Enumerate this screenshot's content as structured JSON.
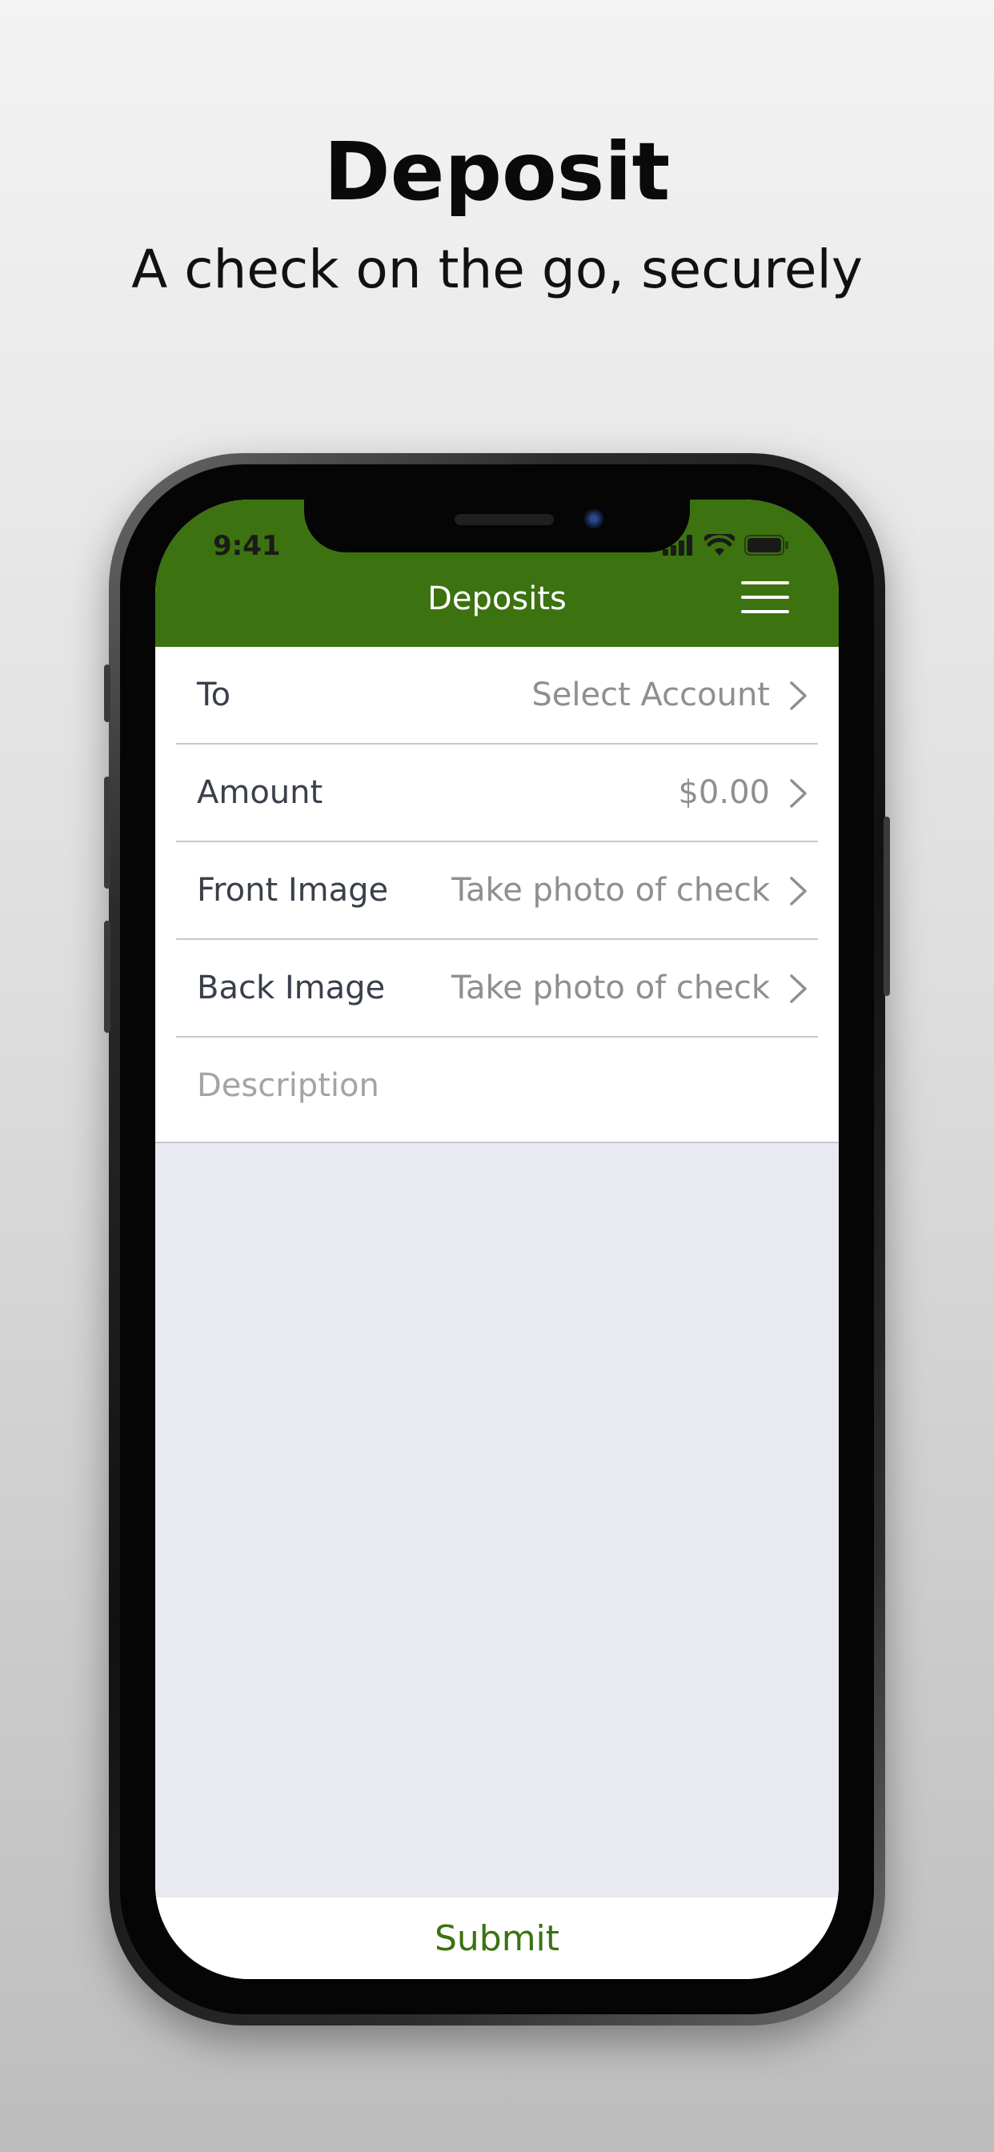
{
  "promo": {
    "title": "Deposit",
    "subtitle": "A check on the go, securely"
  },
  "status_bar": {
    "time": "9:41",
    "icons": [
      "signal-icon",
      "wifi-icon",
      "battery-icon"
    ]
  },
  "nav": {
    "title": "Deposits",
    "menu_icon": "hamburger-menu-icon"
  },
  "form": {
    "rows": [
      {
        "label": "To",
        "value": "Select Account"
      },
      {
        "label": "Amount",
        "value": "$0.00"
      },
      {
        "label": "Front Image",
        "value": "Take photo of check"
      },
      {
        "label": "Back Image",
        "value": "Take photo of check"
      }
    ],
    "description_placeholder": "Description"
  },
  "submit_label": "Submit",
  "colors": {
    "brand_green": "#3c720f",
    "content_gray": "#e9e9f2",
    "value_gray": "#8e8e93",
    "label_dark": "#3a3f4b"
  }
}
